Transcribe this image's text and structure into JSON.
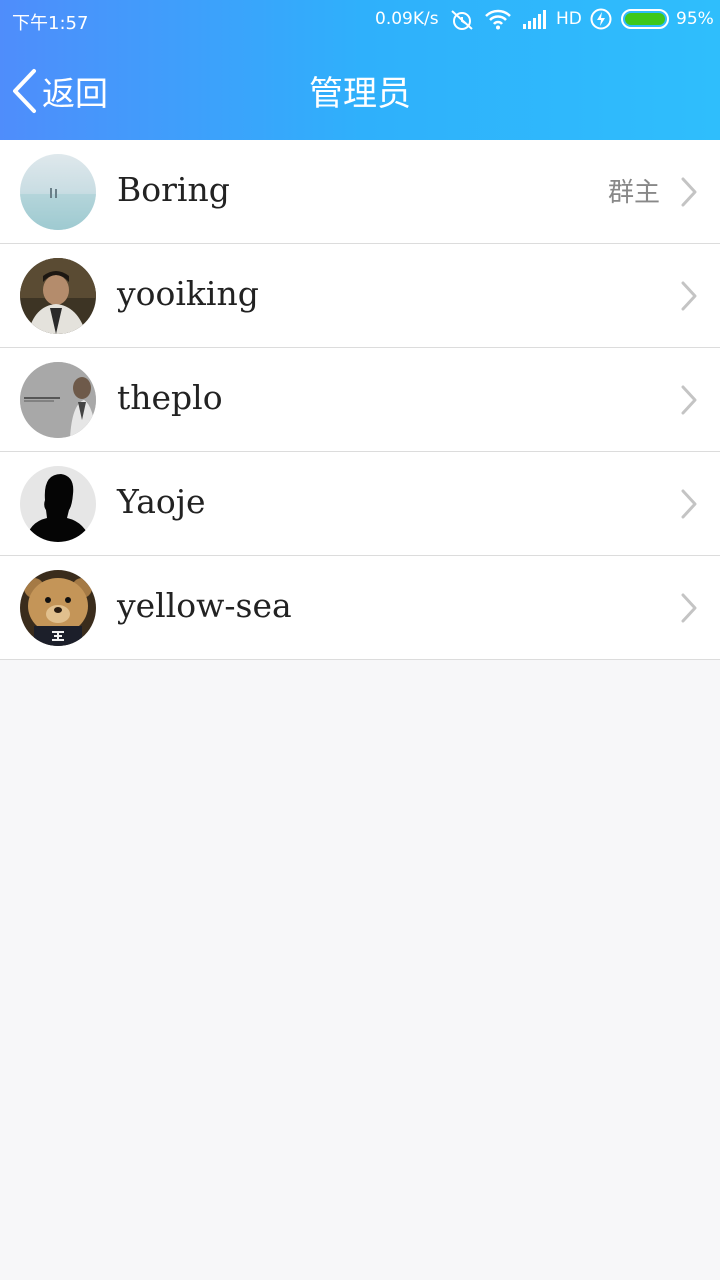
{
  "status_bar": {
    "time": "下午1:57",
    "net_speed": "0.09K/s",
    "network_type": "HD",
    "battery": "95%",
    "icons": [
      "alarm-off-icon",
      "wifi-icon",
      "signal-icon",
      "charging-icon",
      "battery-icon"
    ],
    "battery_color": "#3ec81b"
  },
  "nav": {
    "back_label": "返回",
    "title": "管理员"
  },
  "members": [
    {
      "name": "Boring",
      "role": "群主",
      "avatar": "avatar-landscape"
    },
    {
      "name": "yooiking",
      "role": "",
      "avatar": "avatar-photo-man"
    },
    {
      "name": "theplo",
      "role": "",
      "avatar": "avatar-photo-gray"
    },
    {
      "name": "Yaoje",
      "role": "",
      "avatar": "avatar-default-silhouette"
    },
    {
      "name": "yellow-sea",
      "role": "",
      "avatar": "avatar-teddy-bear"
    }
  ],
  "colors": {
    "header_gradient_start": "#4f8dfb",
    "header_gradient_end": "#2fbefc",
    "background": "#f7f7f9"
  }
}
